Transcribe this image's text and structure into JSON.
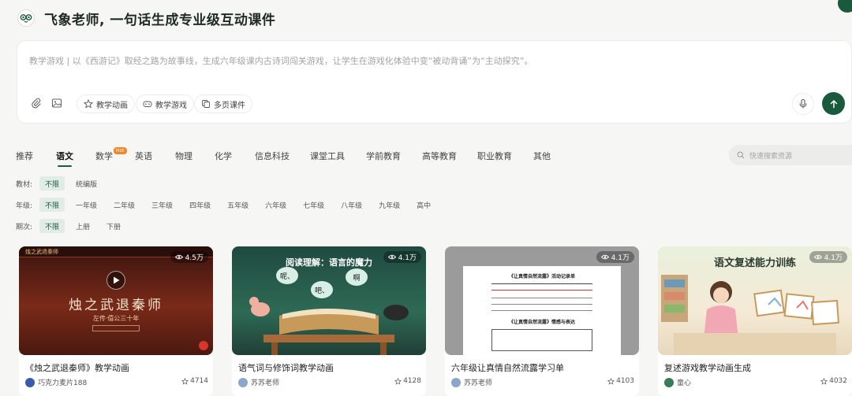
{
  "app": {
    "title": "飞象老师, 一句话生成专业级互动课件"
  },
  "composer": {
    "placeholder": "教学游戏 | 以《西游记》取经之路为故事线，生成六年级课内古诗词闯关游戏，让学生在游戏化体验中变“被动背诵”为“主动探究”。",
    "chips": [
      "教学动画",
      "教学游戏",
      "多页课件"
    ]
  },
  "tabs": {
    "items": [
      "推荐",
      "语文",
      "数学",
      "英语",
      "物理",
      "化学",
      "信息科技",
      "课堂工具",
      "学前教育",
      "高等教育",
      "职业教育",
      "其他"
    ],
    "active": "语文",
    "hot_badge": "Hot"
  },
  "search": {
    "placeholder": "快速搜索资源"
  },
  "filters": {
    "textbook": {
      "label": "教材:",
      "options": [
        "不限",
        "统编版"
      ]
    },
    "grade": {
      "label": "年级:",
      "options": [
        "不限",
        "一年级",
        "二年级",
        "三年级",
        "四年级",
        "五年级",
        "六年级",
        "七年级",
        "八年级",
        "九年级",
        "高中"
      ]
    },
    "term": {
      "label": "期次:",
      "options": [
        "不限",
        "上册",
        "下册"
      ]
    }
  },
  "cards": [
    {
      "title": "《烛之武退秦师》教学动画",
      "author": "巧克力麦片188",
      "stars": "4714",
      "views": "4.5万",
      "thumb_text": "烛之武退秦师",
      "thumb_sub": "左传·僖公三十年",
      "header_text": "烛之武退秦师"
    },
    {
      "title": "语气词与修饰词教学动画",
      "author": "苏苏老师",
      "stars": "4128",
      "views": "4.1万",
      "thumb_text": "阅读理解：语言的魔力",
      "bubbles": [
        "呢、",
        "吧、",
        "啊"
      ]
    },
    {
      "title": "六年级让真情自然流露学习单",
      "author": "苏苏老师",
      "stars": "4103",
      "views": "4.1万",
      "doc_title": "《让真情自然流露》活动记录单",
      "doc_title2": "《让真情自然流露》情感与表达"
    },
    {
      "title": "复述游戏教学动画生成",
      "author": "童心",
      "stars": "4032",
      "views": "4.1万",
      "thumb_text": "语文复述能力训练"
    }
  ],
  "colors": {
    "accent": "#1a5a3c",
    "hot": "#f2842a"
  }
}
